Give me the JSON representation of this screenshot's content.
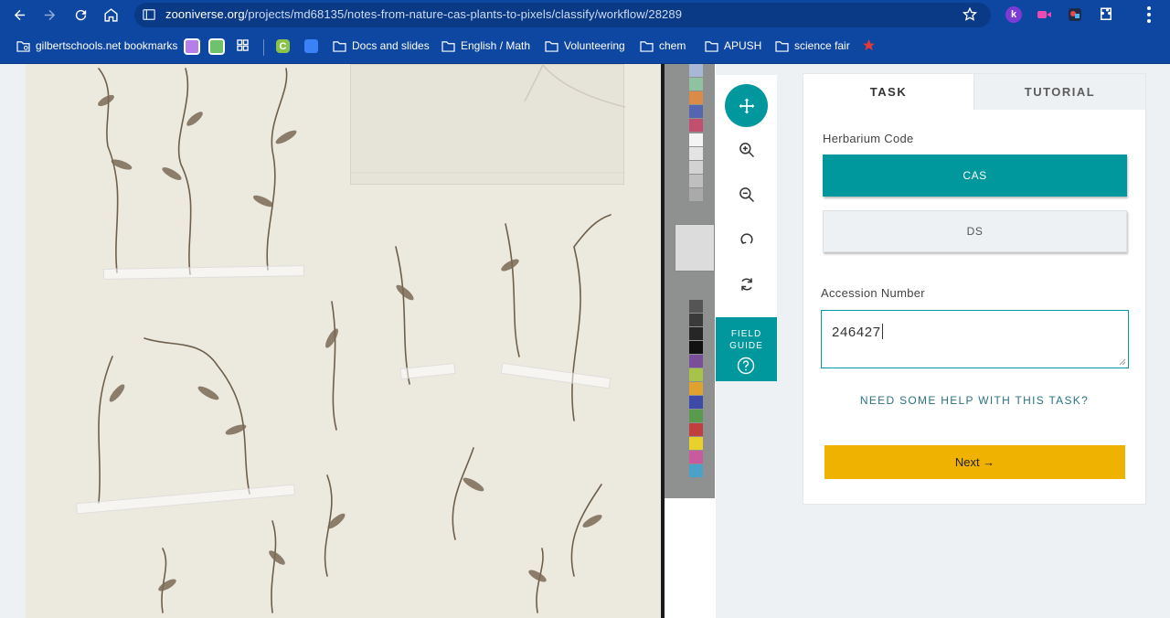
{
  "browser": {
    "url_host": "zooniverse.org",
    "url_path": "/projects/md68135/notes-from-nature-cas-plants-to-pixels/classify/workflow/28289",
    "ext_k_label": "k",
    "bookmarks": [
      "gilbertschools.net bookmarks",
      "Docs and slides",
      "English / Math",
      "Volunteering",
      "chem",
      "APUSH",
      "science fair"
    ],
    "bookmark_c_label": "C"
  },
  "toolbar": {
    "field_guide_label": "FIELD\nGUIDE"
  },
  "task_panel": {
    "tabs": [
      "TASK",
      "TUTORIAL"
    ],
    "question1_label": "Herbarium Code",
    "answers": [
      "CAS",
      "DS"
    ],
    "selected_answer": "CAS",
    "question2_label": "Accession Number",
    "accession_value": "246427",
    "help_link": "NEED SOME HELP WITH THIS TASK?",
    "next_button": "Next →"
  },
  "colors": {
    "browser_chrome": "#0d47a1",
    "accent_teal": "#00979d",
    "next_button": "#f0b200",
    "help_link": "#2a7382"
  }
}
